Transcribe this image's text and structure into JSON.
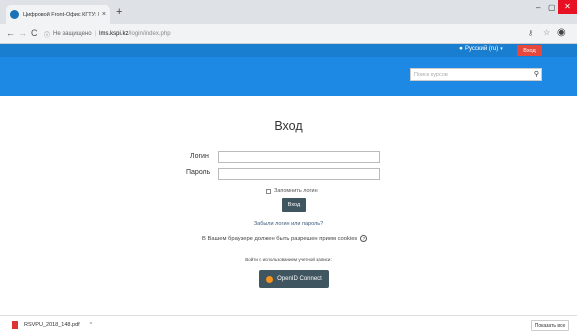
{
  "browser": {
    "tab_title": "Цифровой Front-Офис КГТУ: Вход на сайт",
    "tab_close_glyph": "×",
    "new_tab_glyph": "+",
    "window_controls": {
      "minimize": "–",
      "maximize": "▢",
      "close": "✕"
    },
    "nav": {
      "back": "←",
      "forward": "→",
      "reload": "C"
    },
    "address": {
      "security_label": "Не защищено",
      "separator": "|",
      "host": "lms.kspi.kz",
      "path": "/login/index.php"
    },
    "icons": {
      "key": "key-icon",
      "star": "star-icon",
      "profile": "profile-icon"
    }
  },
  "site_header": {
    "language_label": "Русский (ru)",
    "login_button": "Вход",
    "search_placeholder": "Поиск курсов",
    "colors": {
      "top_band": "#1a7ed0",
      "nav_band": "#1e88e5",
      "login_button": "#e8483c"
    }
  },
  "login_form": {
    "title": "Вход",
    "username_label": "Логин",
    "password_label": "Пароль",
    "remember_label": "Запомнить логин",
    "submit_label": "Вход",
    "forgot_link": "Забыли логин или пароль?",
    "cookies_notice": "В Вашем браузере должен быть разрешен прием cookies",
    "alt_login_label": "Войти с использованием учетной записи:",
    "openid_button": "OpenID Connect",
    "button_color": "#3f555f"
  },
  "downloads": {
    "file_name": "RSVPU_2018_148.pdf",
    "show_all": "Показать все"
  }
}
